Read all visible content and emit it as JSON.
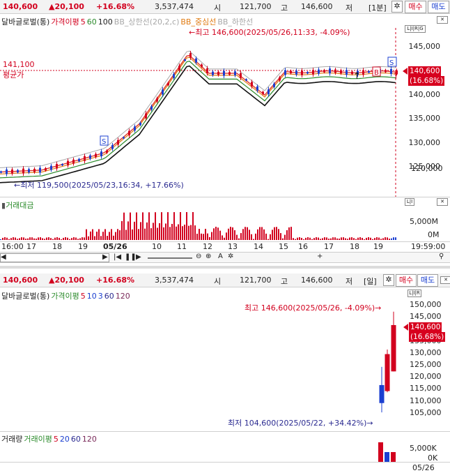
{
  "top": {
    "header": {
      "price": "140,600",
      "change": "▲20,100",
      "rate": "+16.68%",
      "volume": "3,537,474",
      "open_label": "시",
      "open": "121,700",
      "high_label": "고",
      "high": "146,600",
      "low_label": "저",
      "period": "[1분]",
      "buy": "매수",
      "sell": "매도"
    },
    "legend": {
      "name": "달바글로벌(통)",
      "ma_label": "가격이평",
      "ma5": "5",
      "ma60": "60",
      "ma100": "100",
      "bb_upper": "BB_상한선(20,2,c)",
      "bb_mid": "BB_중심선",
      "bb_lower": "BB_하한선"
    },
    "annotations": {
      "high": "←최고 146,600(2025/05/26,11:33, -4.09%)",
      "low": "←최저 119,500(2025/05/23,16:34, +17.66%)",
      "avg_value": "141,100",
      "avg_label": "평균가",
      "price_tag": "140,600",
      "rate_tag": "(16.68%)"
    },
    "price_axis": [
      "145,000",
      "140,000",
      "135,000",
      "130,000",
      "125,000",
      "120,000"
    ],
    "volume_panel": {
      "title": "거래대금",
      "axis": [
        "5,000M",
        "0M"
      ]
    },
    "time_axis": [
      "16:00",
      "17",
      "18",
      "19",
      "05/26",
      "10",
      "11",
      "12",
      "13",
      "14",
      "15",
      "16",
      "17",
      "18",
      "19",
      "19:59:00"
    ]
  },
  "bottom": {
    "header": {
      "price": "140,600",
      "change": "▲20,100",
      "rate": "+16.68%",
      "volume": "3,537,474",
      "open_label": "시",
      "open": "121,700",
      "high_label": "고",
      "high": "146,600",
      "low_label": "저",
      "period": "[일]",
      "buy": "매수",
      "sell": "매도"
    },
    "legend": {
      "name": "달바글로벌(통)",
      "ma_label": "가격이평",
      "ma5": "5",
      "ma10": "10",
      "ma3": "3",
      "ma60": "60",
      "ma120": "120"
    },
    "annotations": {
      "high": "최고 146,600(2025/05/26, -4.09%)→",
      "low": "최저 104,600(2025/05/22, +34.42%)→",
      "price_tag": "140,600",
      "rate_tag": "(16.68%)"
    },
    "price_axis": [
      "150,000",
      "145,000",
      "140,000",
      "135,000",
      "130,000",
      "125,000",
      "120,000",
      "115,000",
      "110,000",
      "105,000"
    ],
    "volume_panel": {
      "title": "거래량",
      "ma_label": "거래이평",
      "ma5": "5",
      "ma20": "20",
      "ma60": "60",
      "ma120": "120",
      "axis": [
        "5,000K",
        "0K"
      ]
    },
    "time_axis": [
      "05/26"
    ]
  },
  "toolbar_icons": [
    "scroll-left-icon",
    "scroll-right-icon",
    "first-icon",
    "pause-icon",
    "play-icon",
    "last-icon",
    "zoom-slider",
    "zoom-out-icon",
    "zoom-in-icon",
    "text-tool-icon",
    "settings-icon",
    "bookmark-icon"
  ],
  "colors": {
    "up": "#d2001e",
    "down": "#1b3fd0",
    "ma5": "#e0332a",
    "ma60": "#2a8a2a",
    "ma100": "#111111",
    "bb": "#e07a10"
  }
}
